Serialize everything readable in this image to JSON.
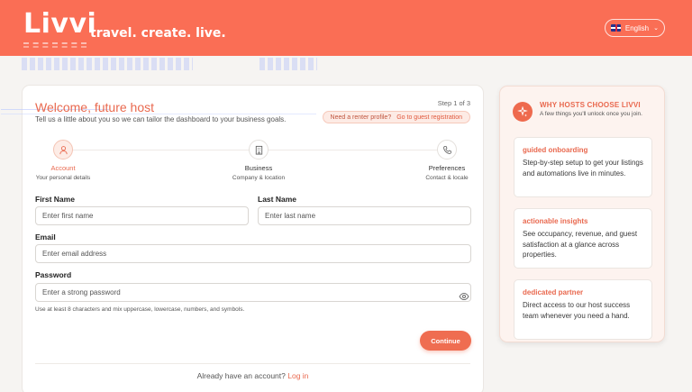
{
  "header": {
    "logo": "Livvi",
    "tagline": "travel. create. live.",
    "language": "English"
  },
  "form": {
    "title": "Welcome, future host",
    "subtitle": "Tell us a little about you so we can tailor the dashboard to your business goals.",
    "step_indicator": "Step 1 of 3",
    "renter_question": "Need a renter profile?",
    "renter_link": "Go to guest registration",
    "steps": [
      {
        "label": "Account",
        "sub": "Your personal details",
        "icon": "user-icon",
        "active": true
      },
      {
        "label": "Business",
        "sub": "Company & location",
        "icon": "building-icon",
        "active": false
      },
      {
        "label": "Preferences",
        "sub": "Contact & locale",
        "icon": "phone-icon",
        "active": false
      }
    ],
    "first_name": {
      "label": "First Name",
      "placeholder": "Enter first name",
      "value": ""
    },
    "last_name": {
      "label": "Last Name",
      "placeholder": "Enter last name",
      "value": ""
    },
    "email": {
      "label": "Email",
      "placeholder": "Enter email address",
      "value": ""
    },
    "password": {
      "label": "Password",
      "placeholder": "Enter a strong password",
      "value": ""
    },
    "password_hint": "Use at least 8 characters and mix uppercase, lowercase, numbers, and symbols.",
    "continue_label": "Continue",
    "already_text": "Already have an account?",
    "login_link": "Log in"
  },
  "sidebar": {
    "title": "WHY HOSTS CHOOSE LIVVI",
    "subtitle": "A few things you'll unlock once you join.",
    "features": [
      {
        "title": "guided onboarding",
        "desc": "Step-by-step setup to get your listings and automations live in minutes."
      },
      {
        "title": "actionable insights",
        "desc": "See occupancy, revenue, and guest satisfaction at a glance across properties."
      },
      {
        "title": "dedicated partner",
        "desc": "Direct access to our host success team whenever you need a hand."
      }
    ]
  },
  "colors": {
    "brand": "#fa6e55",
    "accent": "#e9694f",
    "page_background": "#f6f4f2"
  }
}
